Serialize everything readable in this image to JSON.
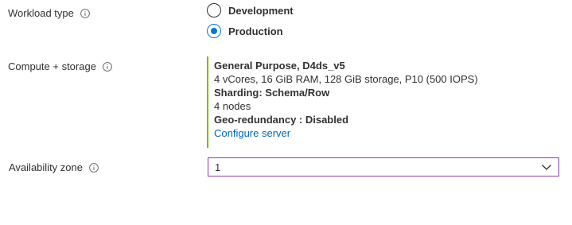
{
  "workload_type": {
    "label": "Workload type",
    "info_icon": "info-icon",
    "options": [
      {
        "label": "Development",
        "selected": false
      },
      {
        "label": "Production",
        "selected": true
      }
    ]
  },
  "compute_storage": {
    "label": "Compute + storage",
    "info_icon": "info-icon",
    "accent_color": "#7fba00",
    "tier": "General Purpose, D4ds_v5",
    "specs": "4 vCores, 16 GiB RAM, 128 GiB storage, P10 (500 IOPS)",
    "sharding": "Sharding: Schema/Row",
    "nodes": "4 nodes",
    "geo_redundancy": "Geo-redundancy : Disabled",
    "configure_link": "Configure server"
  },
  "availability_zone": {
    "label": "Availability zone",
    "info_icon": "info-icon",
    "selected_value": "1",
    "chevron_icon": "chevron-down-icon"
  }
}
